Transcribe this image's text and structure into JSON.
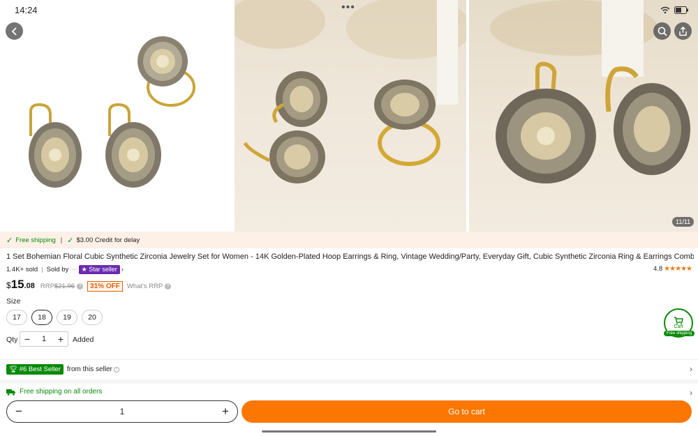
{
  "status_bar": {
    "time": "14:24"
  },
  "gallery": {
    "counter": "11/11"
  },
  "shipping_banner": {
    "free_shipping": "Free shipping",
    "separator": "|",
    "credit": "$3.00 Credit for delay"
  },
  "product": {
    "title": "1 Set Bohemian Floral Cubic Synthetic Zirconia Jewelry Set for Women - 14K Golden-Plated Hoop Earrings & Ring, Vintage Wedding/Party, Everyday Gift, Cubic Synthetic Zirconia Ring & Earrings Combo (No)",
    "sold": "1.4K+ sold",
    "sold_by": "Sold by",
    "seller_dash": "--",
    "star_seller": "Star seller",
    "rating": "4.8",
    "rating_stars": 5
  },
  "price": {
    "currency": "$",
    "whole": "15",
    "decimal": ".08",
    "rrp_label": "RRP",
    "rrp_value": "$21.96",
    "discount": "31% OFF",
    "whats_rrp": "What's RRP"
  },
  "size": {
    "label": "Size",
    "options": [
      "17",
      "18",
      "19",
      "20"
    ],
    "selected": "18"
  },
  "qty": {
    "label": "Qty",
    "value": "1",
    "added": "Added"
  },
  "best_seller": {
    "badge": "#6 Best Seller",
    "text": "from this seller"
  },
  "free_shipping_all": "Free shipping on all orders",
  "floating_cart": {
    "label": "Cart",
    "badge": "Free shipping"
  },
  "bottom_bar": {
    "qty": "1",
    "go_to_cart": "Go to cart"
  },
  "colors": {
    "accent": "#fb7701",
    "green": "#0a8a0a",
    "star_seller": "#6b2bb0"
  }
}
